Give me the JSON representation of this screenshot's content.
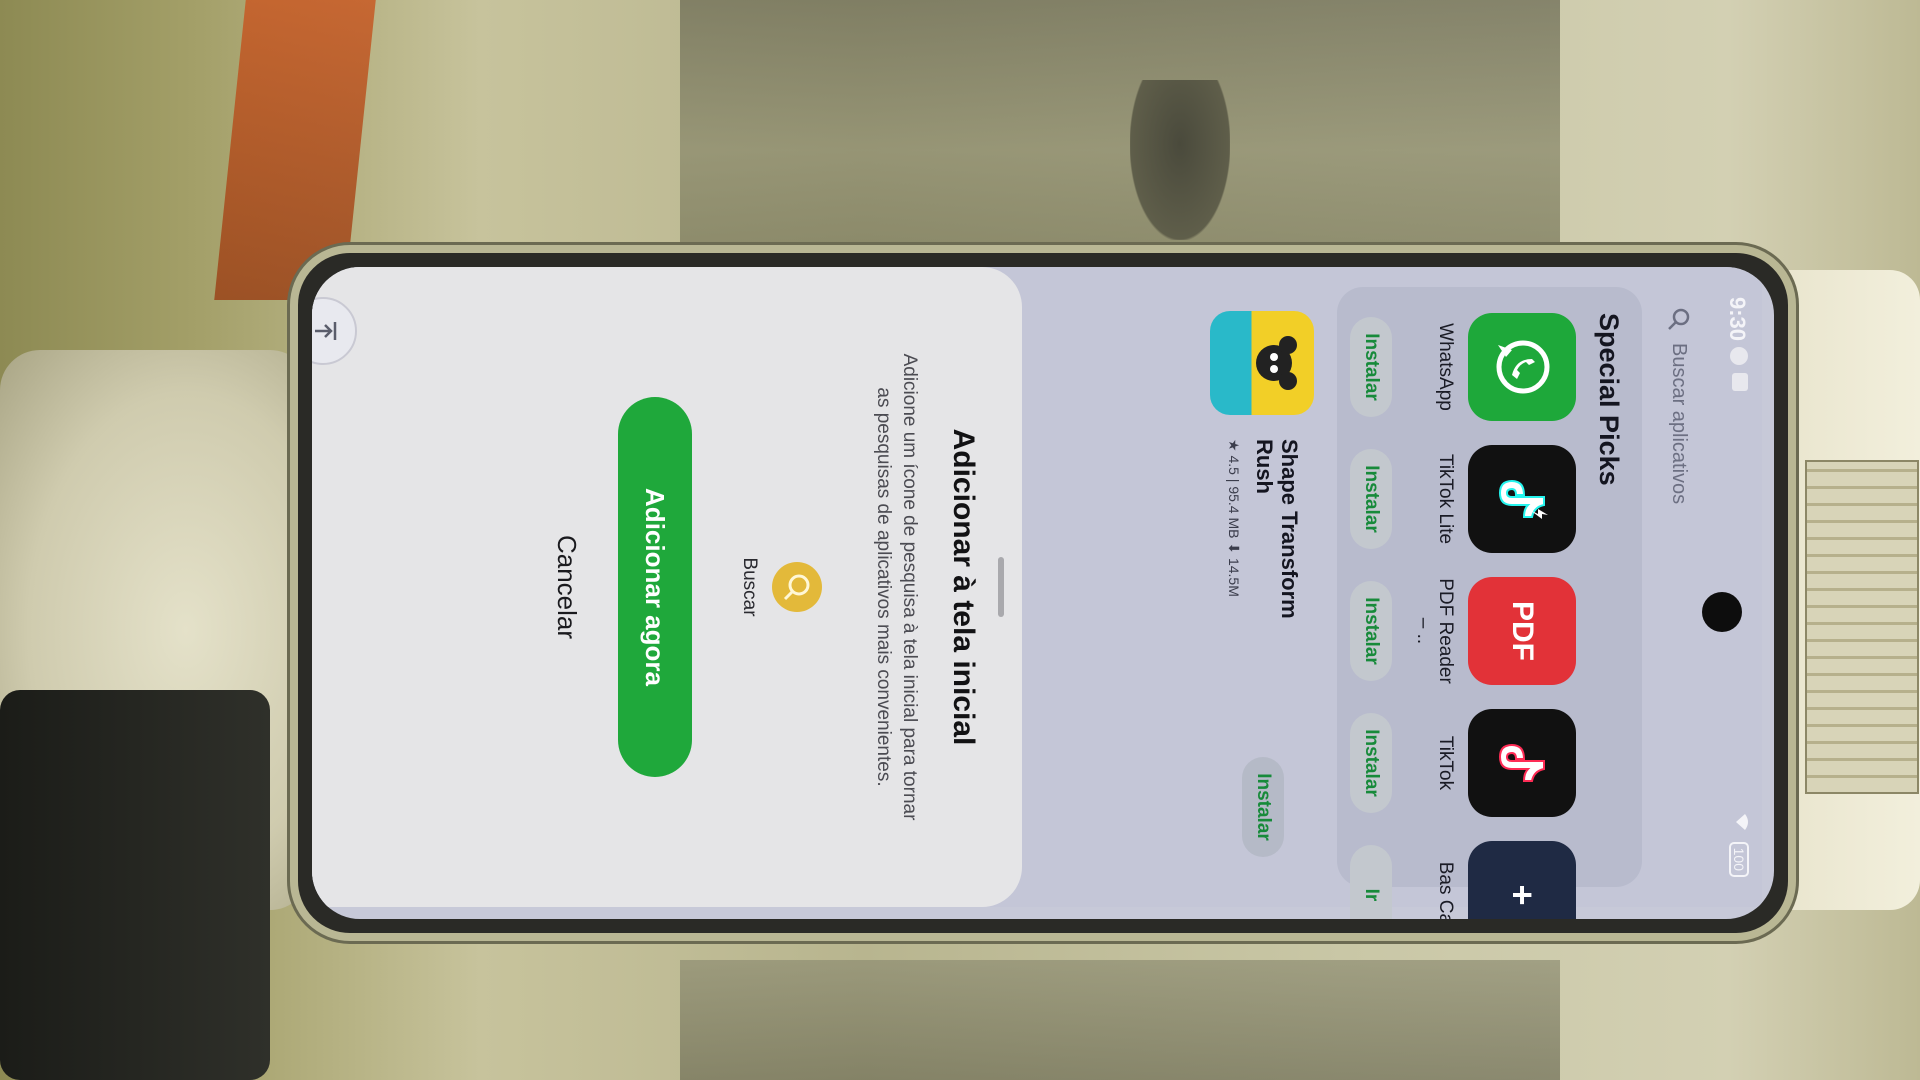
{
  "status_bar": {
    "time": "9:30",
    "battery": "100"
  },
  "search": {
    "placeholder": "Buscar aplicativos"
  },
  "special_picks": {
    "title": "Special Picks",
    "apps": [
      {
        "name": "WhatsApp",
        "icon": "whatsapp-icon",
        "color": "#1ea83a",
        "action": "Instalar"
      },
      {
        "name": "TikTok Lite",
        "icon": "tiktok-lite-icon",
        "color": "#111111",
        "action": "Instalar"
      },
      {
        "name": "PDF Reader – ..",
        "icon": "pdf-icon",
        "color": "#e23238",
        "action": "Instalar"
      },
      {
        "name": "TikTok",
        "icon": "tiktok-icon",
        "color": "#111111",
        "action": "Instalar"
      },
      {
        "name": "Bas Cal",
        "icon": "calculator-icon",
        "color": "#1f2a44",
        "action": "Ir"
      }
    ]
  },
  "featured_app": {
    "name": "Shape Transform Rush",
    "meta": "★ 4.5 | 95.4 MB ⬇ 14.5M",
    "action": "Instalar"
  },
  "sheet": {
    "title": "Adicionar à tela inicial",
    "description": "Adicione um ícone de pesquisa à tela inicial para tornar as pesquisas de aplicativos mais convenientes.",
    "icon_label": "Buscar",
    "primary": "Adicionar agora",
    "cancel": "Cancelar"
  },
  "colors": {
    "accent": "#1fa83b",
    "install_text": "#178a3a"
  }
}
